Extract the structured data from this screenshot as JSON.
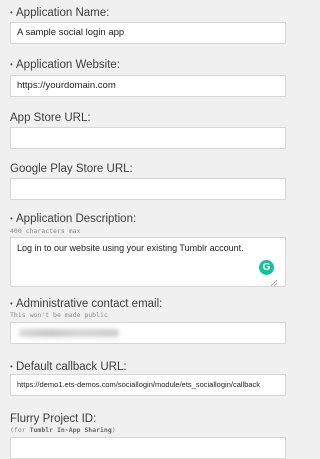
{
  "form": {
    "app_name": {
      "label": "Application Name:",
      "value": "A sample social login app"
    },
    "app_website": {
      "label": "Application Website:",
      "value": "https://yourdomain.com"
    },
    "app_store_url": {
      "label": "App Store URL:",
      "value": ""
    },
    "google_play_url": {
      "label": "Google Play Store URL:",
      "value": ""
    },
    "app_description": {
      "label": "Application Description:",
      "hint": "400 characters max",
      "value": "Log in to our website using your existing Tumblr account."
    },
    "admin_email": {
      "label": "Administrative contact email:",
      "hint": "This won't be made public"
    },
    "callback_url": {
      "label": "Default callback URL:",
      "value": "https://demo1.ets-demos.com/sociallogin/module/ets_sociallogin/callback"
    },
    "flurry_id": {
      "label": "Flurry Project ID:",
      "hint_prefix": "(for ",
      "hint_bold": "Tumblr In-App Sharing",
      "hint_suffix": ")",
      "value": ""
    }
  },
  "required_marker": "•",
  "grammarly_glyph": "G",
  "colors": {
    "page_bg": "#f0f0f0",
    "input_bg": "#ffffff",
    "grammarly": "#15c39a"
  }
}
